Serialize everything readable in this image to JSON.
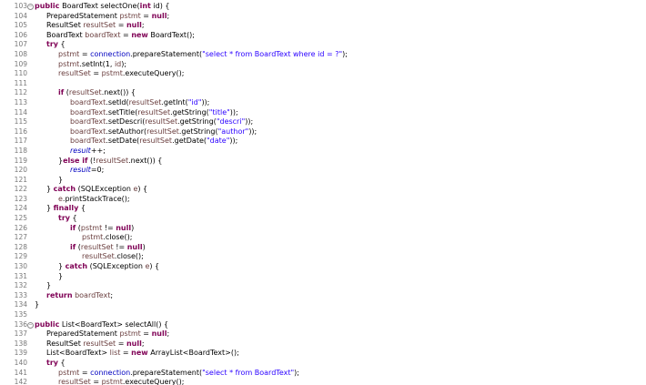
{
  "editor": {
    "lines": [
      {
        "num": "103",
        "fold": true,
        "indent": 0,
        "tokens": [
          [
            "kw",
            "public "
          ],
          [
            "txt",
            "BoardText selectOne("
          ],
          [
            "kw",
            "int"
          ],
          [
            "txt",
            " id) {"
          ]
        ]
      },
      {
        "num": "104",
        "indent": 1,
        "tokens": [
          [
            "txt",
            "PreparedStatement "
          ],
          [
            "var",
            "pstmt"
          ],
          [
            "txt",
            " = "
          ],
          [
            "kw",
            "null"
          ],
          [
            "txt",
            ";"
          ]
        ]
      },
      {
        "num": "105",
        "indent": 1,
        "tokens": [
          [
            "txt",
            "ResultSet "
          ],
          [
            "var",
            "resultSet"
          ],
          [
            "txt",
            " = "
          ],
          [
            "kw",
            "null"
          ],
          [
            "txt",
            ";"
          ]
        ]
      },
      {
        "num": "106",
        "indent": 1,
        "tokens": [
          [
            "txt",
            "BoardText "
          ],
          [
            "var",
            "boardText"
          ],
          [
            "txt",
            " = "
          ],
          [
            "kw",
            "new"
          ],
          [
            "txt",
            " BoardText();"
          ]
        ]
      },
      {
        "num": "107",
        "indent": 1,
        "tokens": [
          [
            "kw",
            "try"
          ],
          [
            "txt",
            " {"
          ]
        ]
      },
      {
        "num": "108",
        "indent": 2,
        "tokens": [
          [
            "var",
            "pstmt"
          ],
          [
            "txt",
            " = "
          ],
          [
            "fld",
            "connection"
          ],
          [
            "txt",
            ".prepareStatement("
          ],
          [
            "str",
            "\"select * from BoardText where id = ?\""
          ],
          [
            "txt",
            ");"
          ]
        ]
      },
      {
        "num": "109",
        "indent": 2,
        "tokens": [
          [
            "var",
            "pstmt"
          ],
          [
            "txt",
            ".setInt(1, "
          ],
          [
            "var",
            "id"
          ],
          [
            "txt",
            ");"
          ]
        ]
      },
      {
        "num": "110",
        "indent": 2,
        "tokens": [
          [
            "var",
            "resultSet"
          ],
          [
            "txt",
            " = "
          ],
          [
            "var",
            "pstmt"
          ],
          [
            "txt",
            ".executeQuery();"
          ]
        ]
      },
      {
        "num": "111",
        "indent": 0,
        "tokens": []
      },
      {
        "num": "112",
        "indent": 2,
        "tokens": [
          [
            "kw",
            "if"
          ],
          [
            "txt",
            " ("
          ],
          [
            "var",
            "resultSet"
          ],
          [
            "txt",
            ".next()) {"
          ]
        ]
      },
      {
        "num": "113",
        "indent": 3,
        "tokens": [
          [
            "var",
            "boardText"
          ],
          [
            "txt",
            ".setId("
          ],
          [
            "var",
            "resultSet"
          ],
          [
            "txt",
            ".getInt("
          ],
          [
            "str",
            "\"id\""
          ],
          [
            "txt",
            "));"
          ]
        ]
      },
      {
        "num": "114",
        "indent": 3,
        "tokens": [
          [
            "var",
            "boardText"
          ],
          [
            "txt",
            ".setTitle("
          ],
          [
            "var",
            "resultSet"
          ],
          [
            "txt",
            ".getString("
          ],
          [
            "str",
            "\"title\""
          ],
          [
            "txt",
            "));"
          ]
        ]
      },
      {
        "num": "115",
        "indent": 3,
        "tokens": [
          [
            "var",
            "boardText"
          ],
          [
            "txt",
            ".setDescri("
          ],
          [
            "var",
            "resultSet"
          ],
          [
            "txt",
            ".getString("
          ],
          [
            "str",
            "\"descri\""
          ],
          [
            "txt",
            "));"
          ]
        ]
      },
      {
        "num": "116",
        "indent": 3,
        "tokens": [
          [
            "var",
            "boardText"
          ],
          [
            "txt",
            ".setAuthor("
          ],
          [
            "var",
            "resultSet"
          ],
          [
            "txt",
            ".getString("
          ],
          [
            "str",
            "\"author\""
          ],
          [
            "txt",
            "));"
          ]
        ]
      },
      {
        "num": "117",
        "indent": 3,
        "tokens": [
          [
            "var",
            "boardText"
          ],
          [
            "txt",
            ".setDate("
          ],
          [
            "var",
            "resultSet"
          ],
          [
            "txt",
            ".getDate("
          ],
          [
            "str",
            "\"date\""
          ],
          [
            "txt",
            "));"
          ]
        ]
      },
      {
        "num": "118",
        "indent": 3,
        "tokens": [
          [
            "ita",
            "result"
          ],
          [
            "txt",
            "++;"
          ]
        ]
      },
      {
        "num": "119",
        "indent": 2,
        "tokens": [
          [
            "txt",
            "}"
          ],
          [
            "kw",
            "else if"
          ],
          [
            "txt",
            " (!"
          ],
          [
            "var",
            "resultSet"
          ],
          [
            "txt",
            ".next()) {"
          ]
        ]
      },
      {
        "num": "120",
        "indent": 3,
        "tokens": [
          [
            "ita",
            "result"
          ],
          [
            "txt",
            "=0;"
          ]
        ]
      },
      {
        "num": "121",
        "indent": 2,
        "tokens": [
          [
            "txt",
            "}"
          ]
        ]
      },
      {
        "num": "122",
        "indent": 1,
        "tokens": [
          [
            "txt",
            "} "
          ],
          [
            "kw",
            "catch"
          ],
          [
            "txt",
            " (SQLException "
          ],
          [
            "var",
            "e"
          ],
          [
            "txt",
            ") {"
          ]
        ]
      },
      {
        "num": "123",
        "indent": 2,
        "tokens": [
          [
            "var",
            "e"
          ],
          [
            "txt",
            ".printStackTrace();"
          ]
        ]
      },
      {
        "num": "124",
        "indent": 1,
        "tokens": [
          [
            "txt",
            "} "
          ],
          [
            "kw",
            "finally"
          ],
          [
            "txt",
            " {"
          ]
        ]
      },
      {
        "num": "125",
        "indent": 2,
        "tokens": [
          [
            "kw",
            "try"
          ],
          [
            "txt",
            " {"
          ]
        ]
      },
      {
        "num": "126",
        "indent": 3,
        "tokens": [
          [
            "kw",
            "if"
          ],
          [
            "txt",
            " ("
          ],
          [
            "var",
            "pstmt"
          ],
          [
            "txt",
            " != "
          ],
          [
            "kw",
            "null"
          ],
          [
            "txt",
            ")"
          ]
        ]
      },
      {
        "num": "127",
        "indent": 4,
        "tokens": [
          [
            "var",
            "pstmt"
          ],
          [
            "txt",
            ".close();"
          ]
        ]
      },
      {
        "num": "128",
        "indent": 3,
        "tokens": [
          [
            "kw",
            "if"
          ],
          [
            "txt",
            " ("
          ],
          [
            "var",
            "resultSet"
          ],
          [
            "txt",
            " != "
          ],
          [
            "kw",
            "null"
          ],
          [
            "txt",
            ")"
          ]
        ]
      },
      {
        "num": "129",
        "indent": 4,
        "tokens": [
          [
            "var",
            "resultSet"
          ],
          [
            "txt",
            ".close();"
          ]
        ]
      },
      {
        "num": "130",
        "indent": 2,
        "tokens": [
          [
            "txt",
            "} "
          ],
          [
            "kw",
            "catch"
          ],
          [
            "txt",
            " (SQLException "
          ],
          [
            "var",
            "e"
          ],
          [
            "txt",
            ") {"
          ]
        ]
      },
      {
        "num": "131",
        "indent": 2,
        "tokens": [
          [
            "txt",
            "}"
          ]
        ]
      },
      {
        "num": "132",
        "indent": 1,
        "tokens": [
          [
            "txt",
            "}"
          ]
        ]
      },
      {
        "num": "133",
        "indent": 1,
        "tokens": [
          [
            "kw",
            "return"
          ],
          [
            "txt",
            " "
          ],
          [
            "var",
            "boardText"
          ],
          [
            "txt",
            ";"
          ]
        ]
      },
      {
        "num": "134",
        "indent": 0,
        "tokens": [
          [
            "txt",
            "}"
          ]
        ]
      },
      {
        "num": "135",
        "indent": 0,
        "tokens": []
      },
      {
        "num": "136",
        "fold": true,
        "indent": 0,
        "tokens": [
          [
            "kw",
            "public"
          ],
          [
            "txt",
            " List<BoardText> selectAll() {"
          ]
        ]
      },
      {
        "num": "137",
        "indent": 1,
        "tokens": [
          [
            "txt",
            "PreparedStatement "
          ],
          [
            "var",
            "pstmt"
          ],
          [
            "txt",
            " = "
          ],
          [
            "kw",
            "null"
          ],
          [
            "txt",
            ";"
          ]
        ]
      },
      {
        "num": "138",
        "indent": 1,
        "tokens": [
          [
            "txt",
            "ResultSet "
          ],
          [
            "var",
            "resultSet"
          ],
          [
            "txt",
            " = "
          ],
          [
            "kw",
            "null"
          ],
          [
            "txt",
            ";"
          ]
        ]
      },
      {
        "num": "139",
        "indent": 1,
        "tokens": [
          [
            "txt",
            "List<BoardText> "
          ],
          [
            "var",
            "list"
          ],
          [
            "txt",
            " = "
          ],
          [
            "kw",
            "new"
          ],
          [
            "txt",
            " ArrayList<BoardText>();"
          ]
        ]
      },
      {
        "num": "140",
        "indent": 1,
        "tokens": [
          [
            "kw",
            "try"
          ],
          [
            "txt",
            " {"
          ]
        ]
      },
      {
        "num": "141",
        "indent": 2,
        "tokens": [
          [
            "var",
            "pstmt"
          ],
          [
            "txt",
            " = "
          ],
          [
            "fld",
            "connection"
          ],
          [
            "txt",
            ".prepareStatement("
          ],
          [
            "str",
            "\"select * from BoardText\""
          ],
          [
            "txt",
            ");"
          ]
        ]
      },
      {
        "num": "142",
        "indent": 2,
        "tokens": [
          [
            "var",
            "resultSet"
          ],
          [
            "txt",
            " = "
          ],
          [
            "var",
            "pstmt"
          ],
          [
            "txt",
            ".executeQuery();"
          ]
        ]
      }
    ]
  }
}
